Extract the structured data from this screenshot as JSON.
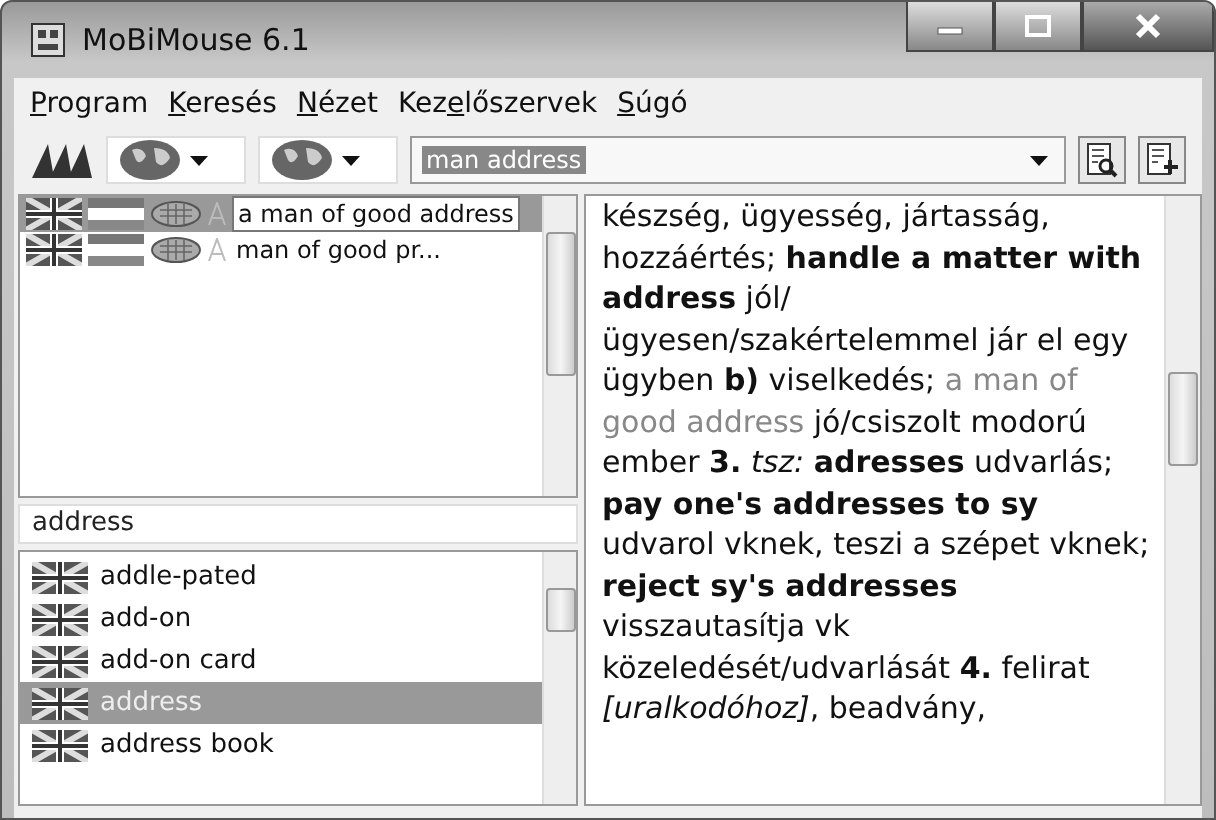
{
  "window": {
    "title": "MoBiMouse 6.1"
  },
  "menu": [
    {
      "key": "P",
      "after": "rogram"
    },
    {
      "key": "K",
      "after": "eresés"
    },
    {
      "key": "N",
      "after": "ézet"
    },
    {
      "before": "Kez",
      "key": "e",
      "after": "lőszervek"
    },
    {
      "key": "S",
      "after": "úgó"
    }
  ],
  "search": {
    "value": "man address"
  },
  "results": [
    {
      "text": "a man of good address",
      "selected": true,
      "tooltip": true
    },
    {
      "text": "man of good pr...",
      "selected": false,
      "tooltip": false
    }
  ],
  "word_search": {
    "value": "address"
  },
  "words": [
    {
      "text": "addle-pated",
      "selected": false
    },
    {
      "text": "add-on",
      "selected": false
    },
    {
      "text": "add-on card",
      "selected": false
    },
    {
      "text": "address",
      "selected": true
    },
    {
      "text": "address book",
      "selected": false
    }
  ],
  "article": [
    {
      "kind": "text",
      "text": "készség, ügyesség, jártasság, hozzáértés; **handle a matter with address** jól/ügyesen/szakértelemmel jár el egy ügyben **b)** viselkedés; "
    },
    {
      "kind": "example",
      "text": "a man of good address"
    },
    {
      "kind": "text",
      "text": " jó/csiszolt modorú ember **3.** *tsz:* **adresses** udvarlás; **pay one's addresses to sy** udvarol vknek, teszi a szépet vknek; **reject sy's addresses** visszautasítja vk közeledését/udvarlását **4.** felirat *[uralkodóhoz]*, beadvány,"
    }
  ]
}
